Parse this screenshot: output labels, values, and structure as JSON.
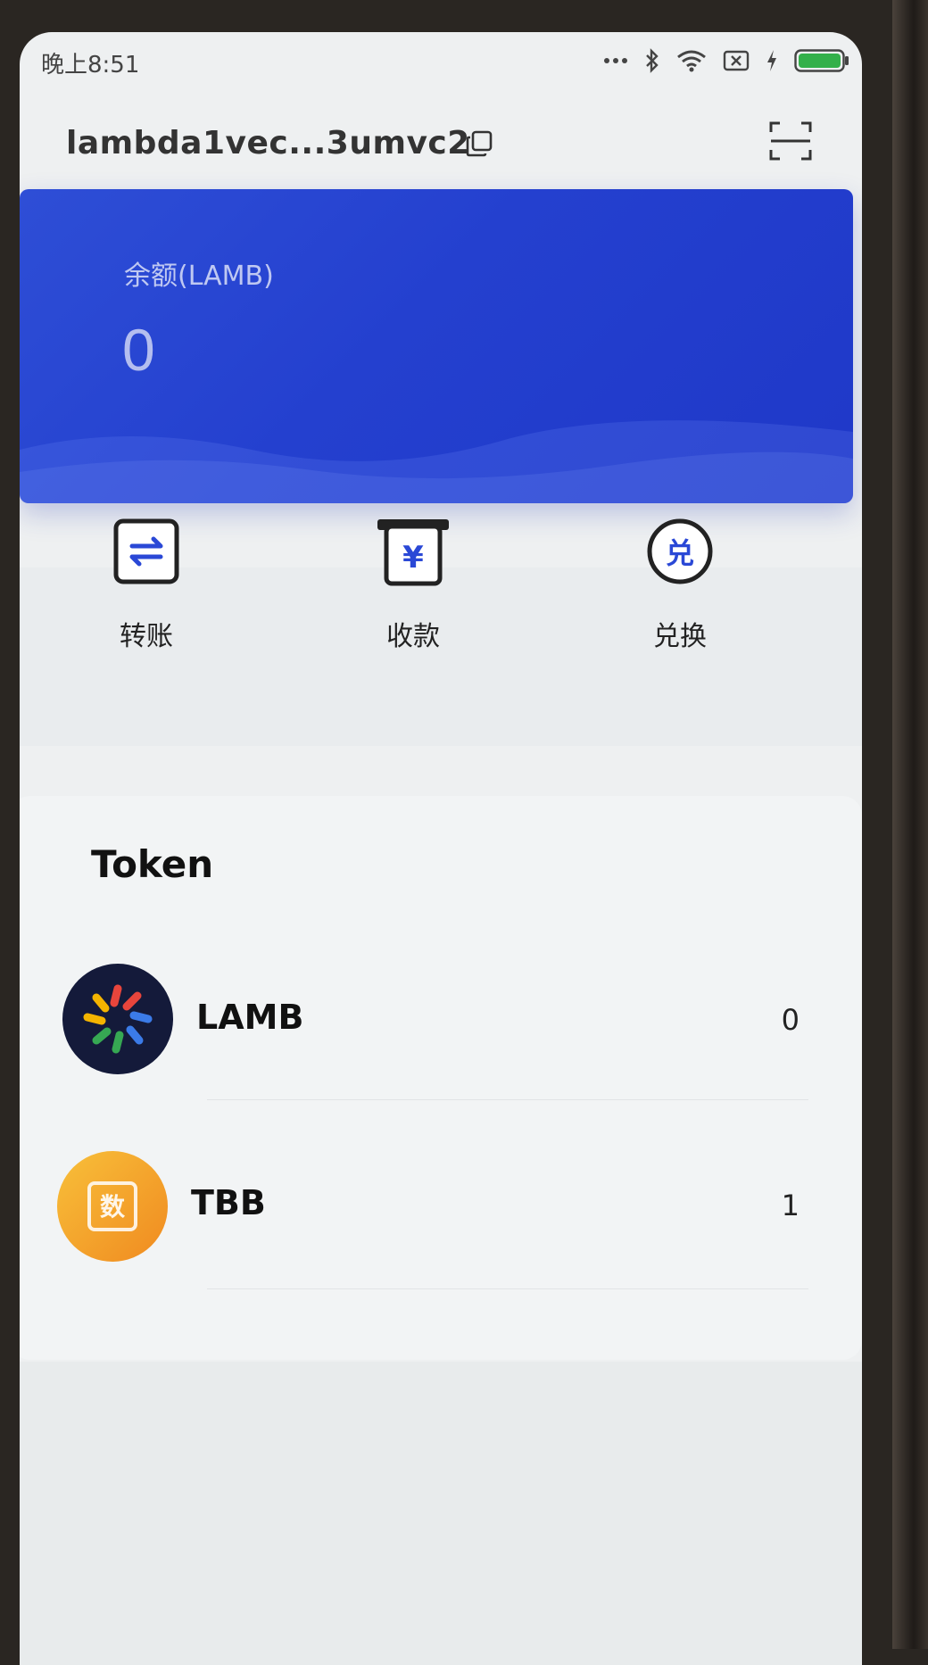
{
  "status_bar": {
    "time": "晚上8:51",
    "icons": [
      "dots-icon",
      "bluetooth-icon",
      "wifi-icon",
      "sim-x-icon",
      "charging-icon",
      "battery-icon"
    ]
  },
  "header": {
    "address": "lambda1vec...3umvc2",
    "icons": [
      "copy-icon",
      "scan-icon"
    ]
  },
  "balance": {
    "label": "余额(LAMB)",
    "value": "0"
  },
  "actions": [
    {
      "label": "转账",
      "icon": "transfer-icon",
      "glyph": "⇋"
    },
    {
      "label": "收款",
      "icon": "receive-icon",
      "glyph": "¥"
    },
    {
      "label": "兑换",
      "icon": "exchange-icon",
      "glyph": "兑"
    }
  ],
  "tokens": {
    "title": "Token",
    "items": [
      {
        "name": "LAMB",
        "amount": "0",
        "icon": "lamb-logo"
      },
      {
        "name": "TBB",
        "amount": "1",
        "icon": "tbb-logo",
        "logo_text": "数"
      }
    ]
  },
  "colors": {
    "accent": "#2440cf",
    "icon_accent": "#2a48d6",
    "tbb_orange": "#f5a02a"
  }
}
